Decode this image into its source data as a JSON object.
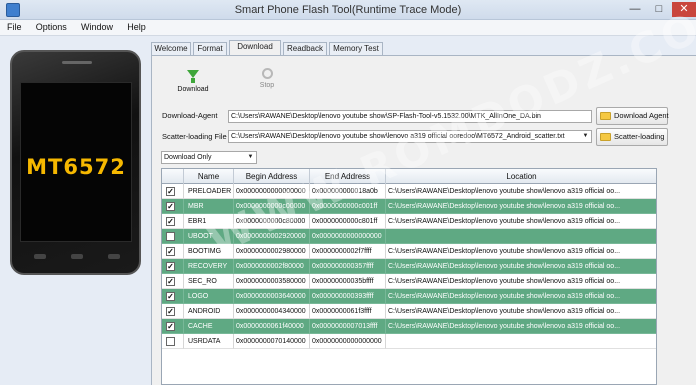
{
  "window": {
    "title": "Smart Phone Flash Tool(Runtime Trace Mode)",
    "min_label": "—",
    "max_label": "□",
    "close_label": "✕"
  },
  "menu": [
    "File",
    "Options",
    "Window",
    "Help"
  ],
  "phone": {
    "chip_label": "MT6572"
  },
  "tabs": [
    {
      "label": "Welcome",
      "active": false
    },
    {
      "label": "Format",
      "active": false
    },
    {
      "label": "Download",
      "active": true
    },
    {
      "label": "Readback",
      "active": false
    },
    {
      "label": "Memory Test",
      "active": false
    }
  ],
  "toolbar": {
    "download_label": "Download",
    "stop_label": "Stop"
  },
  "download_agent": {
    "label": "Download-Agent",
    "value": "C:\\Users\\RAWANE\\Desktop\\lenovo youtube show\\SP-Flash-Tool-v5.1532.00\\MTK_AllInOne_DA.bin",
    "button": "Download Agent"
  },
  "scatter": {
    "label": "Scatter-loading File",
    "value": "C:\\Users\\RAWANE\\Desktop\\lenovo youtube show\\lenovo a319 official ooredoo\\MT6572_Android_scatter.txt",
    "button": "Scatter-loading"
  },
  "mode_select": {
    "value": "Download Only"
  },
  "table": {
    "headers": [
      "",
      "Name",
      "Begin Address",
      "End Address",
      "Location"
    ],
    "rows": [
      {
        "checked": true,
        "name": "PRELOADER",
        "begin": "0x0000000000000000",
        "end": "0x000000000018a0b",
        "location": "C:\\Users\\RAWANE\\Desktop\\lenovo youtube show\\lenovo a319 official oo...",
        "highlight": false
      },
      {
        "checked": true,
        "name": "MBR",
        "begin": "0x0000000000c00000",
        "end": "0x0000000000c001ff",
        "location": "C:\\Users\\RAWANE\\Desktop\\lenovo youtube show\\lenovo a319 official oo...",
        "highlight": true
      },
      {
        "checked": true,
        "name": "EBR1",
        "begin": "0x0000000000c80000",
        "end": "0x0000000000c801ff",
        "location": "C:\\Users\\RAWANE\\Desktop\\lenovo youtube show\\lenovo a319 official oo...",
        "highlight": false
      },
      {
        "checked": false,
        "name": "UBOOT",
        "begin": "0x0000000002920000",
        "end": "0x0000000000000000",
        "location": "",
        "highlight": true
      },
      {
        "checked": true,
        "name": "BOOTIMG",
        "begin": "0x0000000002980000",
        "end": "0x0000000002f7ffff",
        "location": "C:\\Users\\RAWANE\\Desktop\\lenovo youtube show\\lenovo a319 official oo...",
        "highlight": false
      },
      {
        "checked": true,
        "name": "RECOVERY",
        "begin": "0x0000000002f80000",
        "end": "0x000000000357ffff",
        "location": "C:\\Users\\RAWANE\\Desktop\\lenovo youtube show\\lenovo a319 official oo...",
        "highlight": true
      },
      {
        "checked": true,
        "name": "SEC_RO",
        "begin": "0x0000000003580000",
        "end": "0x00000000035bffff",
        "location": "C:\\Users\\RAWANE\\Desktop\\lenovo youtube show\\lenovo a319 official oo...",
        "highlight": false
      },
      {
        "checked": true,
        "name": "LOGO",
        "begin": "0x0000000003640000",
        "end": "0x000000000393ffff",
        "location": "C:\\Users\\RAWANE\\Desktop\\lenovo youtube show\\lenovo a319 official oo...",
        "highlight": true
      },
      {
        "checked": true,
        "name": "ANDROID",
        "begin": "0x0000000004340000",
        "end": "0x0000000061f3ffff",
        "location": "C:\\Users\\RAWANE\\Desktop\\lenovo youtube show\\lenovo a319 official oo...",
        "highlight": false
      },
      {
        "checked": true,
        "name": "CACHE",
        "begin": "0x0000000061f40000",
        "end": "0x0000000007013ffff",
        "location": "C:\\Users\\RAWANE\\Desktop\\lenovo youtube show\\lenovo a319 official oo...",
        "highlight": true
      },
      {
        "checked": false,
        "name": "USRDATA",
        "begin": "0x0000000070140000",
        "end": "0x0000000000000000",
        "location": "",
        "highlight": false
      }
    ]
  },
  "watermark": "WWW.ROMDODZ.COM",
  "colors": {
    "row_highlight": "#5fa983",
    "chip_text": "#f6b800",
    "download_icon": "#3ea63a"
  }
}
